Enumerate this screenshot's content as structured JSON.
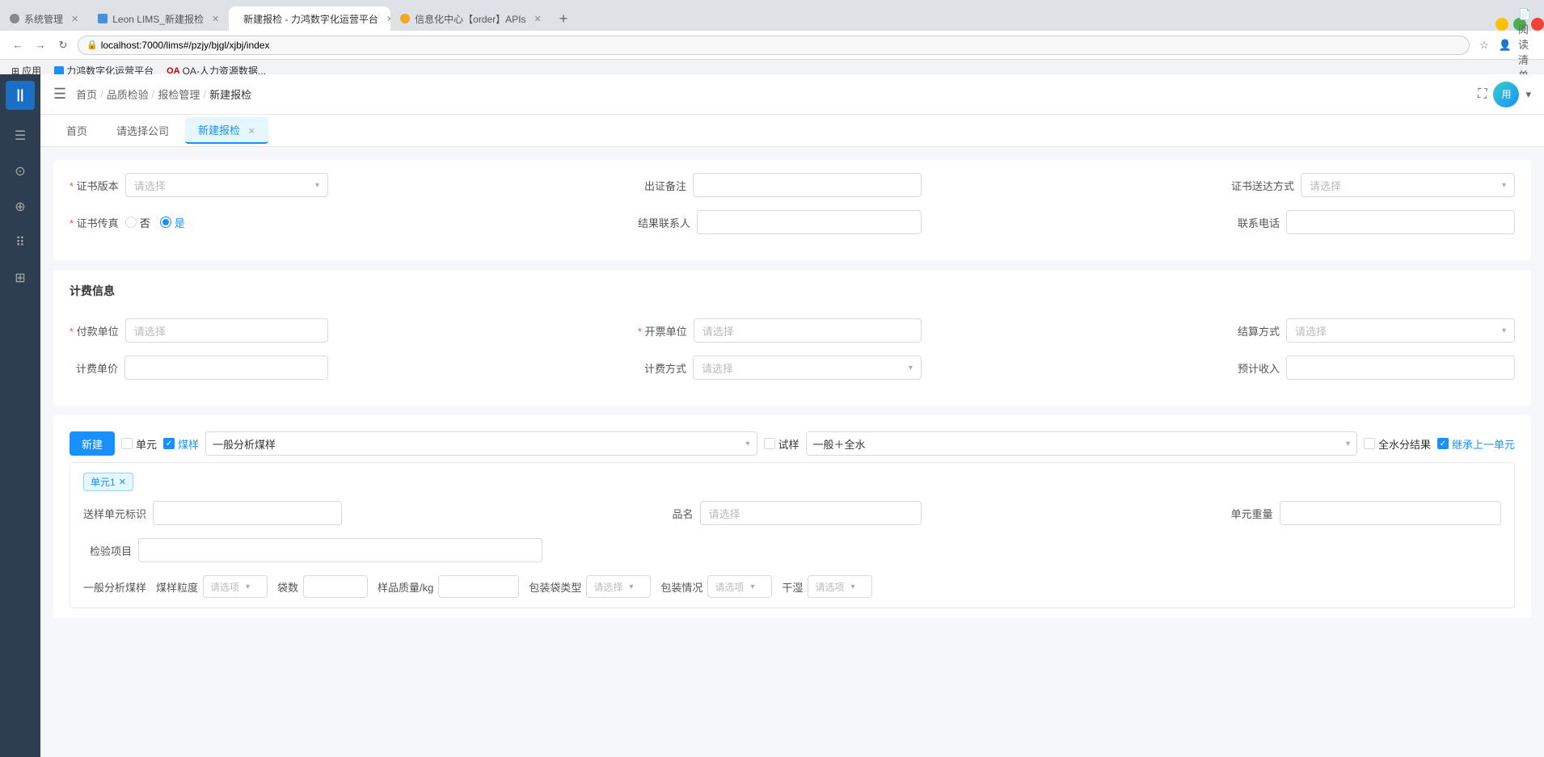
{
  "browser": {
    "tabs": [
      {
        "id": "tab1",
        "label": "系统管理",
        "icon_type": "system",
        "active": false,
        "closeable": true
      },
      {
        "id": "tab2",
        "label": "Leon LIMS_新建报检",
        "icon_type": "lims",
        "active": false,
        "closeable": true
      },
      {
        "id": "tab3",
        "label": "新建报检 - 力鸿数字化运营平台",
        "icon_type": "edit",
        "active": true,
        "closeable": true
      },
      {
        "id": "tab4",
        "label": "信息化中心【order】APIs",
        "icon_type": "info",
        "active": false,
        "closeable": true
      }
    ],
    "address": "localhost:7000/lims#/pzjy/bjgl/xjbj/index",
    "bookmarks": [
      {
        "id": "bm1",
        "label": "应用"
      },
      {
        "id": "bm2",
        "label": "力鸿数字化运营平台"
      },
      {
        "id": "bm3",
        "label": "OA-人力资源数据..."
      }
    ]
  },
  "sidebar": {
    "logo": "||",
    "items": [
      {
        "id": "menu",
        "icon": "☰",
        "label": ""
      },
      {
        "id": "home",
        "icon": "⊙",
        "label": ""
      },
      {
        "id": "plus",
        "icon": "⊕",
        "label": ""
      },
      {
        "id": "dots",
        "icon": "⠿",
        "label": ""
      },
      {
        "id": "grid",
        "icon": "⊞",
        "label": ""
      }
    ]
  },
  "topnav": {
    "breadcrumbs": [
      "首页",
      "品质检验",
      "报检管理",
      "新建报检"
    ],
    "fullscreen_icon": "⛶",
    "avatar_text": "用"
  },
  "page_tabs": [
    {
      "id": "pt1",
      "label": "首页",
      "active": false,
      "closeable": false
    },
    {
      "id": "pt2",
      "label": "请选择公司",
      "active": false,
      "closeable": false
    },
    {
      "id": "pt3",
      "label": "新建报检",
      "active": true,
      "closeable": true
    }
  ],
  "form": {
    "certificate_section": {
      "cert_version_label": "证书版本",
      "cert_version_placeholder": "请选择",
      "cert_remarks_label": "出证备注",
      "cert_delivery_label": "证书送达方式",
      "cert_delivery_placeholder": "请选择",
      "cert_fax_label": "证书传真",
      "radio_no": "否",
      "radio_yes": "是",
      "result_contact_label": "结果联系人",
      "contact_phone_label": "联系电话"
    },
    "billing_section": {
      "title": "计费信息",
      "pay_unit_label": "付款单位",
      "pay_unit_placeholder": "请选择",
      "invoice_unit_label": "开票单位",
      "invoice_unit_placeholder": "请选择",
      "settlement_label": "结算方式",
      "settlement_placeholder": "请选择",
      "fee_unit_label": "计费单价",
      "fee_method_label": "计费方式",
      "fee_method_placeholder": "请选择",
      "expected_income_label": "预计收入"
    },
    "toolbar": {
      "new_btn": "新建",
      "unit_label": "单元",
      "coal_sample_label": "煤样",
      "general_analysis_label": "一般分析煤样",
      "trial_sample_label": "试样",
      "general_full_label": "一般＋全水",
      "full_water_label": "全水分结果",
      "inherit_label": "继承上一单元"
    },
    "unit_section": {
      "unit_tab": "单元1",
      "sample_unit_label": "送样单元标识",
      "product_label": "品名",
      "product_placeholder": "请选择",
      "unit_weight_label": "单元重量",
      "test_items_label": "检验项目",
      "analysis_section_label": "一般分析煤样",
      "coal_particle_label": "煤样粒度",
      "coal_particle_placeholder": "请选项",
      "bags_label": "袋数",
      "sample_quality_label": "样品质量/kg",
      "package_type_label": "包装袋类型",
      "package_type_placeholder": "请选择",
      "package_label": "包装情况",
      "package_placeholder": "请选项",
      "dry_wet_label": "干湿",
      "dry_wet_placeholder": "请选项"
    }
  }
}
